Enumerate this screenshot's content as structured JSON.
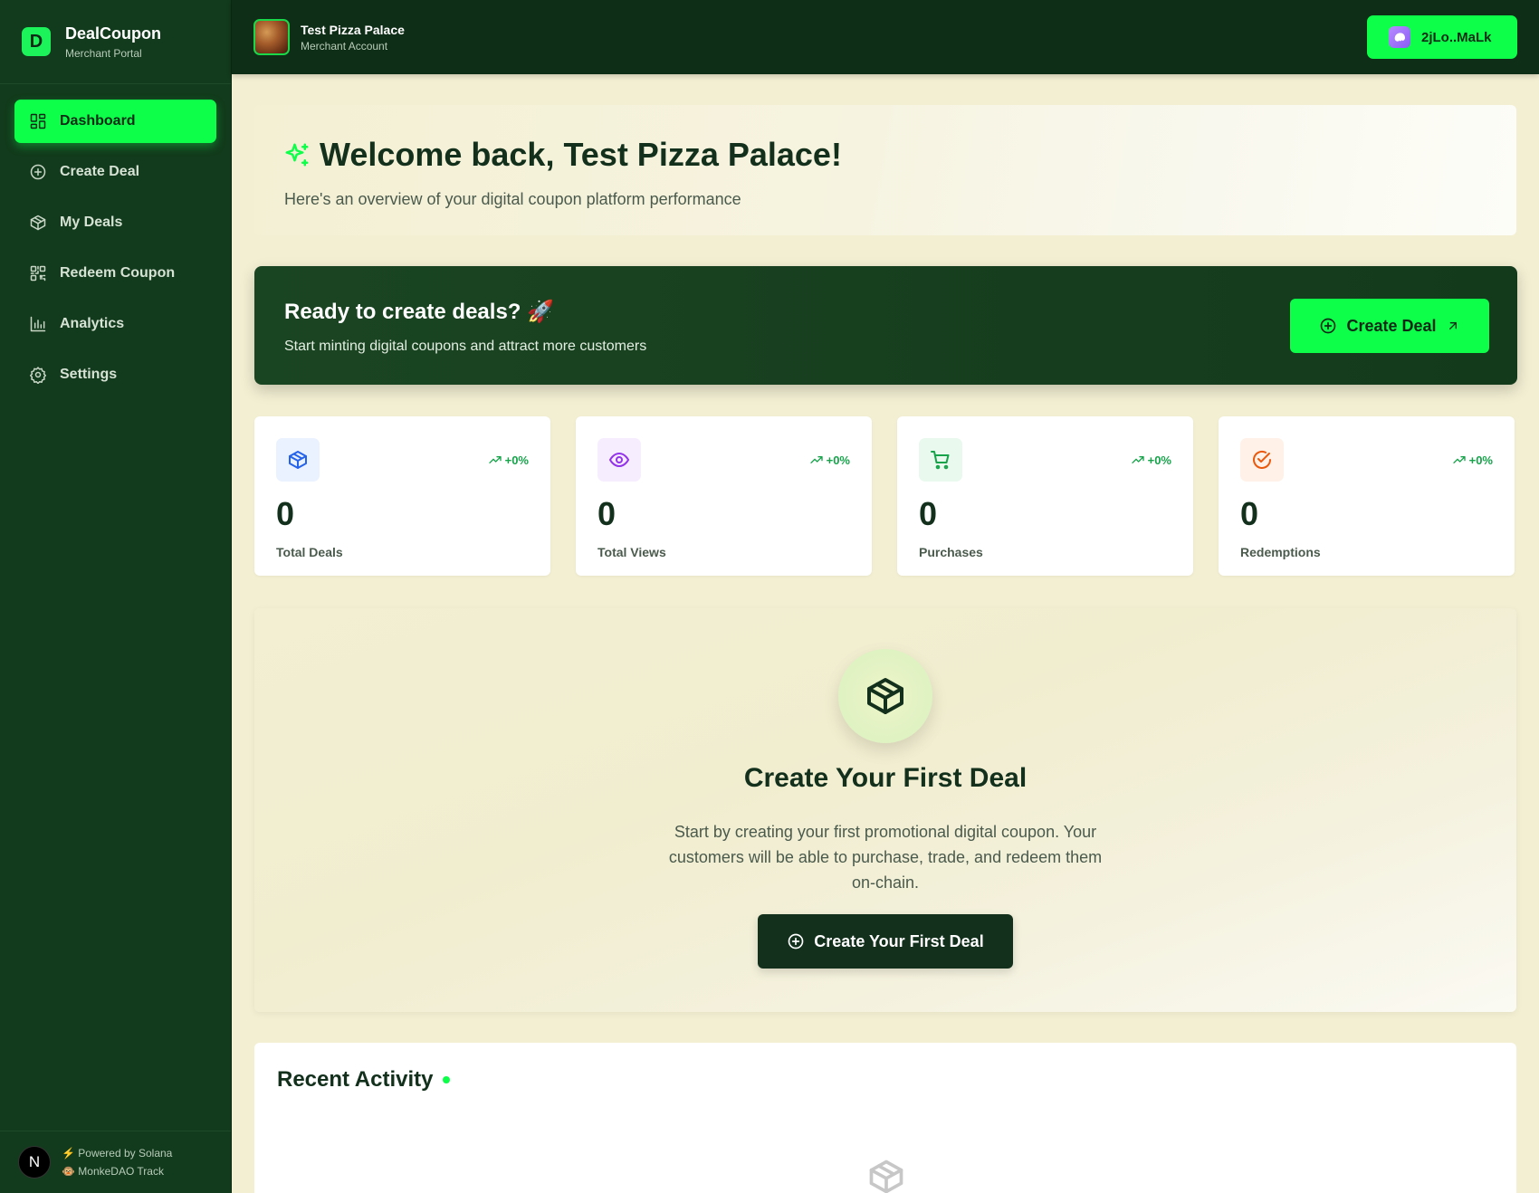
{
  "brand": {
    "logo_letter": "D",
    "name": "DealCoupon",
    "subtitle": "Merchant Portal"
  },
  "sidebar": {
    "items": [
      {
        "label": "Dashboard",
        "icon": "dashboard-grid-icon",
        "active": true
      },
      {
        "label": "Create Deal",
        "icon": "plus-circle-icon",
        "active": false
      },
      {
        "label": "My Deals",
        "icon": "package-icon",
        "active": false
      },
      {
        "label": "Redeem Coupon",
        "icon": "qr-code-icon",
        "active": false
      },
      {
        "label": "Analytics",
        "icon": "bar-chart-icon",
        "active": false
      },
      {
        "label": "Settings",
        "icon": "gear-icon",
        "active": false
      }
    ],
    "footer": {
      "avatar_letter": "N",
      "line1": "⚡ Powered by Solana",
      "line2": "🐵 MonkeDAO Track"
    }
  },
  "header": {
    "merchant_name": "Test Pizza Palace",
    "merchant_subtitle": "Merchant Account",
    "wallet_label": "2jLo..MaLk"
  },
  "welcome": {
    "title": "Welcome back, Test Pizza Palace!",
    "subtitle": "Here's an overview of your digital coupon platform performance"
  },
  "cta": {
    "title": "Ready to create deals? 🚀",
    "subtitle": "Start minting digital coupons and attract more customers",
    "button_label": "Create Deal"
  },
  "stats": [
    {
      "value": "0",
      "label": "Total Deals",
      "trend": "+0%",
      "icon": "package-icon",
      "color": "#2563eb",
      "bg": "#eaf1ff"
    },
    {
      "value": "0",
      "label": "Total Views",
      "trend": "+0%",
      "icon": "eye-icon",
      "color": "#9333ea",
      "bg": "#f6edff"
    },
    {
      "value": "0",
      "label": "Purchases",
      "trend": "+0%",
      "icon": "cart-icon",
      "color": "#16a34a",
      "bg": "#e9f9ee"
    },
    {
      "value": "0",
      "label": "Redemptions",
      "trend": "+0%",
      "icon": "check-circle-icon",
      "color": "#ea580c",
      "bg": "#fff1e8"
    }
  ],
  "empty_state": {
    "title": "Create Your First Deal",
    "text": "Start by creating your first promotional digital coupon. Your customers will be able to purchase, trade, and redeem them on-chain.",
    "button_label": "Create Your First Deal"
  },
  "activity": {
    "title": "Recent Activity"
  },
  "colors": {
    "accent": "#0dff4a",
    "sidebar_bg": "#123a1c",
    "header_bg": "#0f2e17",
    "page_bg": "#f3efd3",
    "text_dark": "#12301c"
  }
}
